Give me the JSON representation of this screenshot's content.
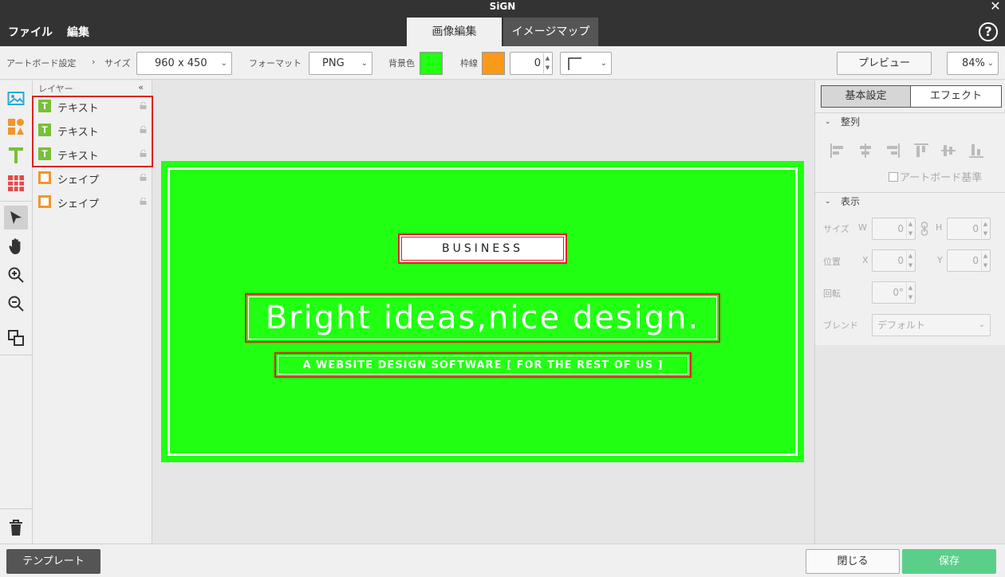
{
  "app": {
    "title": "SiGN",
    "close_glyph": "✕",
    "help_glyph": "?"
  },
  "menu": {
    "file": "ファイル",
    "edit": "編集"
  },
  "tabs": [
    {
      "label": "画像編集",
      "active": true
    },
    {
      "label": "イメージマップ",
      "active": false
    }
  ],
  "toolbar": {
    "artboard_label": "アートボード設定",
    "arrow": "›",
    "size_label": "サイズ",
    "size_value": "960 x 450",
    "format_label": "フォーマット",
    "format_value": "PNG",
    "bg_label": "背景色",
    "bg_color": "#21ff12",
    "border_label": "枠線",
    "border_color": "#f99a1a",
    "border_width": "0",
    "corner_value": "",
    "preview_label": "プレビュー",
    "zoom_value": "84%"
  },
  "tools": [
    {
      "icon": "image-icon"
    },
    {
      "icon": "shapes-icon"
    },
    {
      "icon": "text-icon"
    },
    {
      "icon": "table-icon"
    },
    {
      "icon": "pointer-icon"
    },
    {
      "icon": "hand-icon"
    },
    {
      "icon": "zoom-in-icon"
    },
    {
      "icon": "zoom-out-icon"
    },
    {
      "icon": "arrange-icon"
    },
    {
      "icon": "trash-icon"
    }
  ],
  "layers": {
    "header": "レイヤー",
    "collapse_glyph": "«",
    "text_glyph": "T",
    "items": [
      {
        "type": "text",
        "name": "テキスト",
        "selected": true
      },
      {
        "type": "text",
        "name": "テキスト",
        "selected": true
      },
      {
        "type": "text",
        "name": "テキスト",
        "selected": true
      },
      {
        "type": "shape",
        "name": "シェイプ",
        "selected": false
      },
      {
        "type": "shape",
        "name": "シェイプ",
        "selected": false
      }
    ]
  },
  "artboard": {
    "background": "#21ff12",
    "badge_text": "BUSINESS",
    "headline": "Bright ideas,nice design.",
    "subline": "A WEBSITE DESIGN SOFTWARE [ FOR THE REST OF US ]"
  },
  "panel": {
    "tab_basic": "基本設定",
    "tab_effect": "エフェクト",
    "align_header": "整列",
    "section_glyph": "⌄",
    "artboard_basis": "アートボード基準",
    "display_header": "表示",
    "size_label": "サイズ",
    "w_label": "W",
    "w_value": "0",
    "h_label": "H",
    "h_value": "0",
    "pos_label": "位置",
    "x_label": "X",
    "x_value": "0",
    "y_label": "Y",
    "y_value": "0",
    "rotate_label": "回転",
    "rotate_value": "0°",
    "blend_label": "ブレンド",
    "blend_value": "デフォルト"
  },
  "bottom": {
    "template": "テンプレート",
    "close": "閉じる",
    "save": "保存"
  }
}
